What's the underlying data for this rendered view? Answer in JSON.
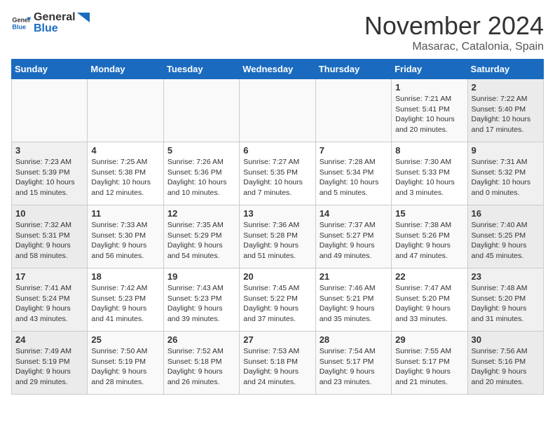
{
  "logo": {
    "line1": "General",
    "line2": "Blue"
  },
  "title": "November 2024",
  "subtitle": "Masarac, Catalonia, Spain",
  "weekdays": [
    "Sunday",
    "Monday",
    "Tuesday",
    "Wednesday",
    "Thursday",
    "Friday",
    "Saturday"
  ],
  "weeks": [
    [
      {
        "day": "",
        "info": ""
      },
      {
        "day": "",
        "info": ""
      },
      {
        "day": "",
        "info": ""
      },
      {
        "day": "",
        "info": ""
      },
      {
        "day": "",
        "info": ""
      },
      {
        "day": "1",
        "info": "Sunrise: 7:21 AM\nSunset: 5:41 PM\nDaylight: 10 hours\nand 20 minutes."
      },
      {
        "day": "2",
        "info": "Sunrise: 7:22 AM\nSunset: 5:40 PM\nDaylight: 10 hours\nand 17 minutes."
      }
    ],
    [
      {
        "day": "3",
        "info": "Sunrise: 7:23 AM\nSunset: 5:39 PM\nDaylight: 10 hours\nand 15 minutes."
      },
      {
        "day": "4",
        "info": "Sunrise: 7:25 AM\nSunset: 5:38 PM\nDaylight: 10 hours\nand 12 minutes."
      },
      {
        "day": "5",
        "info": "Sunrise: 7:26 AM\nSunset: 5:36 PM\nDaylight: 10 hours\nand 10 minutes."
      },
      {
        "day": "6",
        "info": "Sunrise: 7:27 AM\nSunset: 5:35 PM\nDaylight: 10 hours\nand 7 minutes."
      },
      {
        "day": "7",
        "info": "Sunrise: 7:28 AM\nSunset: 5:34 PM\nDaylight: 10 hours\nand 5 minutes."
      },
      {
        "day": "8",
        "info": "Sunrise: 7:30 AM\nSunset: 5:33 PM\nDaylight: 10 hours\nand 3 minutes."
      },
      {
        "day": "9",
        "info": "Sunrise: 7:31 AM\nSunset: 5:32 PM\nDaylight: 10 hours\nand 0 minutes."
      }
    ],
    [
      {
        "day": "10",
        "info": "Sunrise: 7:32 AM\nSunset: 5:31 PM\nDaylight: 9 hours\nand 58 minutes."
      },
      {
        "day": "11",
        "info": "Sunrise: 7:33 AM\nSunset: 5:30 PM\nDaylight: 9 hours\nand 56 minutes."
      },
      {
        "day": "12",
        "info": "Sunrise: 7:35 AM\nSunset: 5:29 PM\nDaylight: 9 hours\nand 54 minutes."
      },
      {
        "day": "13",
        "info": "Sunrise: 7:36 AM\nSunset: 5:28 PM\nDaylight: 9 hours\nand 51 minutes."
      },
      {
        "day": "14",
        "info": "Sunrise: 7:37 AM\nSunset: 5:27 PM\nDaylight: 9 hours\nand 49 minutes."
      },
      {
        "day": "15",
        "info": "Sunrise: 7:38 AM\nSunset: 5:26 PM\nDaylight: 9 hours\nand 47 minutes."
      },
      {
        "day": "16",
        "info": "Sunrise: 7:40 AM\nSunset: 5:25 PM\nDaylight: 9 hours\nand 45 minutes."
      }
    ],
    [
      {
        "day": "17",
        "info": "Sunrise: 7:41 AM\nSunset: 5:24 PM\nDaylight: 9 hours\nand 43 minutes."
      },
      {
        "day": "18",
        "info": "Sunrise: 7:42 AM\nSunset: 5:23 PM\nDaylight: 9 hours\nand 41 minutes."
      },
      {
        "day": "19",
        "info": "Sunrise: 7:43 AM\nSunset: 5:23 PM\nDaylight: 9 hours\nand 39 minutes."
      },
      {
        "day": "20",
        "info": "Sunrise: 7:45 AM\nSunset: 5:22 PM\nDaylight: 9 hours\nand 37 minutes."
      },
      {
        "day": "21",
        "info": "Sunrise: 7:46 AM\nSunset: 5:21 PM\nDaylight: 9 hours\nand 35 minutes."
      },
      {
        "day": "22",
        "info": "Sunrise: 7:47 AM\nSunset: 5:20 PM\nDaylight: 9 hours\nand 33 minutes."
      },
      {
        "day": "23",
        "info": "Sunrise: 7:48 AM\nSunset: 5:20 PM\nDaylight: 9 hours\nand 31 minutes."
      }
    ],
    [
      {
        "day": "24",
        "info": "Sunrise: 7:49 AM\nSunset: 5:19 PM\nDaylight: 9 hours\nand 29 minutes."
      },
      {
        "day": "25",
        "info": "Sunrise: 7:50 AM\nSunset: 5:19 PM\nDaylight: 9 hours\nand 28 minutes."
      },
      {
        "day": "26",
        "info": "Sunrise: 7:52 AM\nSunset: 5:18 PM\nDaylight: 9 hours\nand 26 minutes."
      },
      {
        "day": "27",
        "info": "Sunrise: 7:53 AM\nSunset: 5:18 PM\nDaylight: 9 hours\nand 24 minutes."
      },
      {
        "day": "28",
        "info": "Sunrise: 7:54 AM\nSunset: 5:17 PM\nDaylight: 9 hours\nand 23 minutes."
      },
      {
        "day": "29",
        "info": "Sunrise: 7:55 AM\nSunset: 5:17 PM\nDaylight: 9 hours\nand 21 minutes."
      },
      {
        "day": "30",
        "info": "Sunrise: 7:56 AM\nSunset: 5:16 PM\nDaylight: 9 hours\nand 20 minutes."
      }
    ]
  ]
}
